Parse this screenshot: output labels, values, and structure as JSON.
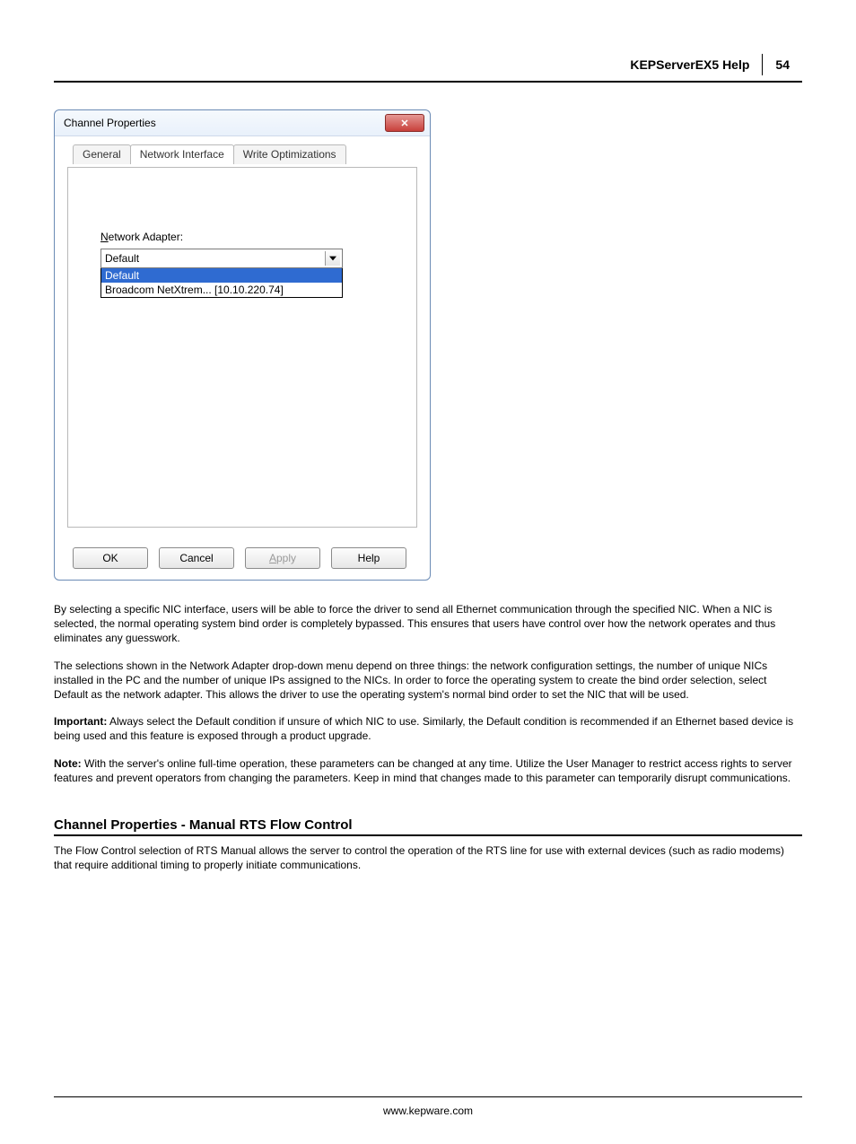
{
  "header": {
    "title": "KEPServerEX5 Help",
    "page": "54"
  },
  "dialog": {
    "title": "Channel Properties",
    "close_glyph": "✕",
    "tabs": [
      "General",
      "Network Interface",
      "Write Optimizations"
    ],
    "active_tab": 1,
    "field_label_pre": "N",
    "field_label_rest": "etwork Adapter:",
    "combo_value": "Default",
    "combo_options": [
      "Default",
      "Broadcom NetXtrem... [10.10.220.74]"
    ],
    "combo_selected": 0,
    "buttons": {
      "ok": "OK",
      "cancel": "Cancel",
      "apply_mn": "A",
      "apply_rest": "pply",
      "help": "Help"
    }
  },
  "body": {
    "p1": "By selecting a specific NIC interface, users will be able to force the driver to send all Ethernet communication through the specified NIC. When a NIC is selected, the normal operating system bind order is completely bypassed. This ensures that users have control over how the network operates and thus eliminates any guesswork.",
    "p2": "The selections shown in the Network Adapter drop-down menu depend on three things: the network configuration settings, the number of unique NICs installed in the PC and the number of unique IPs assigned to the NICs. In order to force the operating system to create the bind order selection, select Default as the network adapter. This allows the driver to use the operating system's normal bind order to set the NIC that will be used.",
    "p3_label": "Important:",
    "p3": " Always select the Default condition if unsure of which NIC to use. Similarly, the Default condition is recommended if an Ethernet based device is being used and this feature is exposed through a product upgrade.",
    "p4_label": "Note:",
    "p4": " With the server's online full-time operation, these parameters can be changed at any time. Utilize the User Manager to restrict access rights to server features and prevent operators from changing the parameters. Keep in mind that changes made to this parameter can temporarily disrupt communications."
  },
  "section": {
    "heading": "Channel Properties - Manual RTS Flow Control",
    "p": "The Flow Control selection of RTS Manual allows the server to control the operation of the RTS line for use with external devices (such as radio modems) that require additional timing to properly initiate communications."
  },
  "footer": "www.kepware.com"
}
